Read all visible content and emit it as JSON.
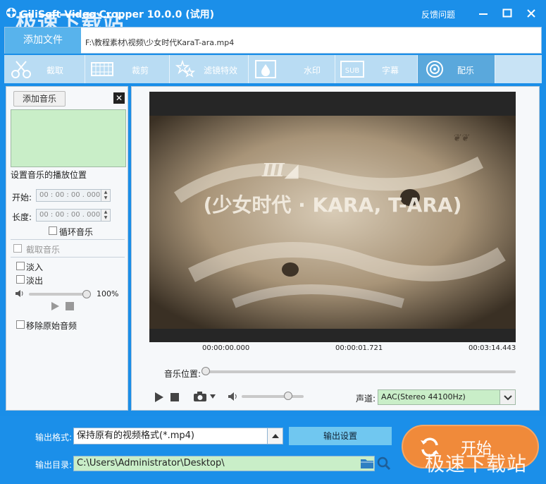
{
  "app": {
    "title": "GiliSoft Video Cropper 10.0.0 (试用)",
    "watermark": "极速下载站",
    "feedback": "反馈问题"
  },
  "filebar": {
    "add_file": "添加文件",
    "path": "F:\\教程素材\\视频\\少女时代KaraT-ara.mp4"
  },
  "tabs": [
    {
      "label": "截取",
      "icon": "scissors-icon"
    },
    {
      "label": "裁剪",
      "icon": "crop-icon"
    },
    {
      "label": "滤镜特效",
      "icon": "stars-icon"
    },
    {
      "label": "水印",
      "icon": "droplet-icon"
    },
    {
      "label": "字幕",
      "icon": "subtitle-icon"
    },
    {
      "label": "配乐",
      "icon": "music-disc-icon"
    }
  ],
  "music": {
    "add_music": "添加音乐",
    "close": "✕",
    "set_position_label": "设置音乐的播放位置",
    "start_label": "开始:",
    "start_value": "00 : 00 : 00 . 000",
    "length_label": "长度:",
    "length_value": "00 : 00 : 00 . 000",
    "loop_label": "循环音乐",
    "trim_label": "截取音乐",
    "fade_in_label": "淡入",
    "fade_out_label": "淡出",
    "volume_percent": "100%",
    "remove_original_label": "移除原始音频"
  },
  "player": {
    "time_start": "00:00:00.000",
    "time_current": "00:00:01.721",
    "time_end": "00:03:14.443",
    "music_position_label": "音乐位置:",
    "channel_label": "声道:",
    "channel_value": "AAC(Stereo 44100Hz)",
    "video_overlay_text": "(少女时代 · KARA, T-ARA)"
  },
  "output": {
    "format_label": "输出格式:",
    "format_value": "保持原有的视频格式(*.mp4)",
    "settings_button": "输出设置",
    "dir_label": "输出目录:",
    "dir_value": "C:\\Users\\Administrator\\Desktop\\",
    "start_button": "开始"
  },
  "colors": {
    "brand_blue": "#1b8fe9",
    "active_tab": "#5aa8dc",
    "start_orange": "#f08a3a",
    "list_green": "#c9eec8"
  }
}
